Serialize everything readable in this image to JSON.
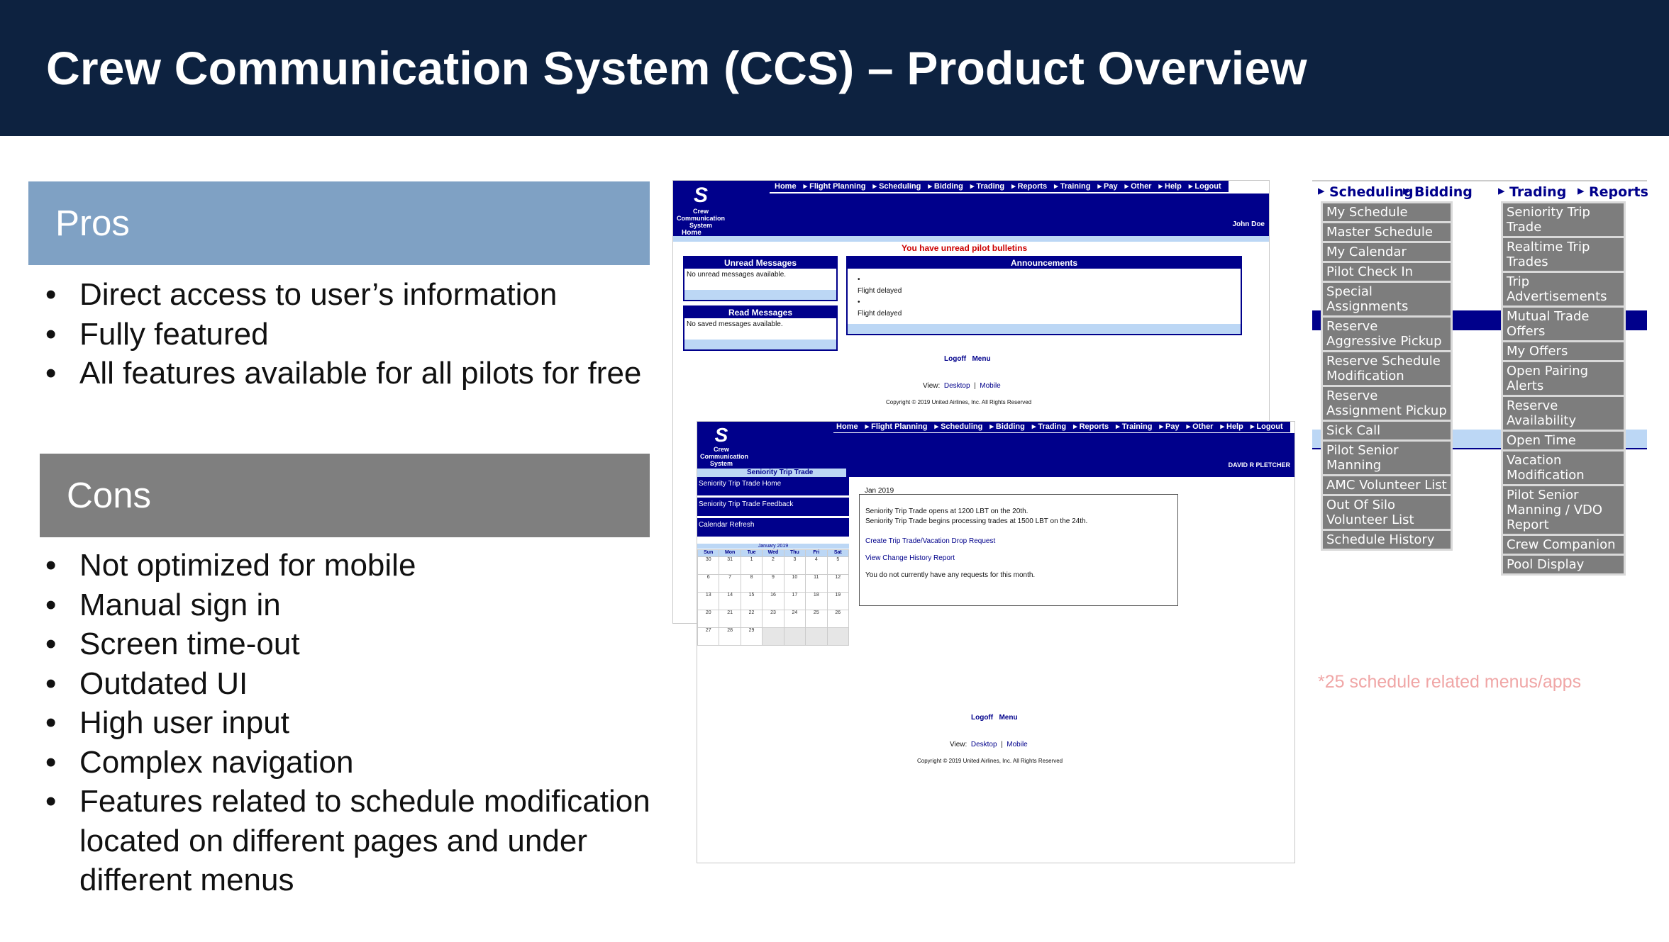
{
  "slide": {
    "title": "Crew Communication System (CCS) – Product Overview",
    "pros": {
      "heading": "Pros",
      "items": [
        "Direct access to user’s information",
        "Fully featured",
        "All features available for all pilots for free"
      ]
    },
    "cons": {
      "heading": "Cons",
      "items": [
        "Not optimized for mobile",
        "Manual sign in",
        "Screen time-out",
        "Outdated UI",
        "High user input",
        "Complex navigation",
        "Features related to schedule modification located on different pages and under different menus"
      ]
    },
    "footnote": "*25 schedule related menus/apps"
  },
  "screen1": {
    "nav": [
      "Home",
      "Flight Planning",
      "Scheduling",
      "Bidding",
      "Trading",
      "Reports",
      "Training",
      "Pay",
      "Other",
      "Help",
      "Logout"
    ],
    "logo_top": "S",
    "logo_text": "Crew Communication System",
    "tab": "Home",
    "user": "John Doe",
    "alert": "You have unread pilot bulletins",
    "unread_title": "Unread Messages",
    "unread_body": "No unread messages available.",
    "read_title": "Read Messages",
    "read_body": "No saved messages available.",
    "ann_title": "Announcements",
    "ann_items": [
      "Flight delayed",
      "Flight delayed"
    ],
    "logoff": "Logoff",
    "menu": "Menu",
    "view_label": "View:",
    "desktop": "Desktop",
    "sep": "|",
    "mobile": "Mobile",
    "copyright": "Copyright © 2019 United Airlines, Inc. All Rights Reserved"
  },
  "screen2": {
    "nav": [
      "Home",
      "Flight Planning",
      "Scheduling",
      "Bidding",
      "Trading",
      "Reports",
      "Training",
      "Pay",
      "Other",
      "Help",
      "Logout"
    ],
    "logo_top": "S",
    "logo_text": "Crew Communication System",
    "tab": "Seniority Trip Trade",
    "user": "DAVID R PLETCHER",
    "side_links": [
      "Seniority Trip Trade Home",
      "Seniority Trip Trade Feedback",
      "Calendar Refresh"
    ],
    "cal_title": "January 2019",
    "cal_days": [
      "Sun",
      "Mon",
      "Tue",
      "Wed",
      "Thu",
      "Fri",
      "Sat"
    ],
    "cal_weeks": [
      [
        "30",
        "31",
        "1",
        "2",
        "3",
        "4",
        "5"
      ],
      [
        "6",
        "7",
        "8",
        "9",
        "10",
        "11",
        "12"
      ],
      [
        "13",
        "14",
        "15",
        "16",
        "17",
        "18",
        "19"
      ],
      [
        "20",
        "21",
        "22",
        "23",
        "24",
        "25",
        "26"
      ],
      [
        "27",
        "28",
        "29",
        "",
        "",
        "",
        ""
      ]
    ],
    "month": "Jan 2019",
    "info1": "Seniority Trip Trade opens at 1200 LBT on the 20th.",
    "info2": "Seniority Trip Trade begins processing trades at 1500 LBT on the 24th.",
    "link1": "Create Trip Trade/Vacation Drop Request",
    "link2": "View Change History Report",
    "no_req": "You do not currently have any requests for this month.",
    "logoff": "Logoff",
    "menu": "Menu",
    "view_label": "View:",
    "desktop": "Desktop",
    "sep": "|",
    "mobile": "Mobile",
    "copyright": "Copyright © 2019 United Airlines, Inc. All Rights Reserved"
  },
  "menus": {
    "headers": [
      "Scheduling",
      "Bidding",
      "Trading",
      "Reports"
    ],
    "col1": [
      "My Schedule",
      "Master Schedule",
      "My Calendar",
      "Pilot Check In",
      "Special Assignments",
      "Reserve Aggressive Pickup",
      "Reserve Schedule Modification",
      "Reserve Assignment Pickup",
      "Sick Call",
      "Pilot Senior Manning",
      "AMC Volunteer List",
      "Out Of Silo Volunteer List",
      "Schedule History"
    ],
    "col2": [
      "Seniority Trip Trade",
      "Realtime Trip Trades",
      "Trip Advertisements",
      "Mutual Trade Offers",
      "My Offers",
      "Open Pairing Alerts",
      "Reserve Availability",
      "Open Time",
      "Vacation Modification",
      "Pilot Senior Manning / VDO Report",
      "Crew Companion",
      "Pool Display"
    ]
  }
}
